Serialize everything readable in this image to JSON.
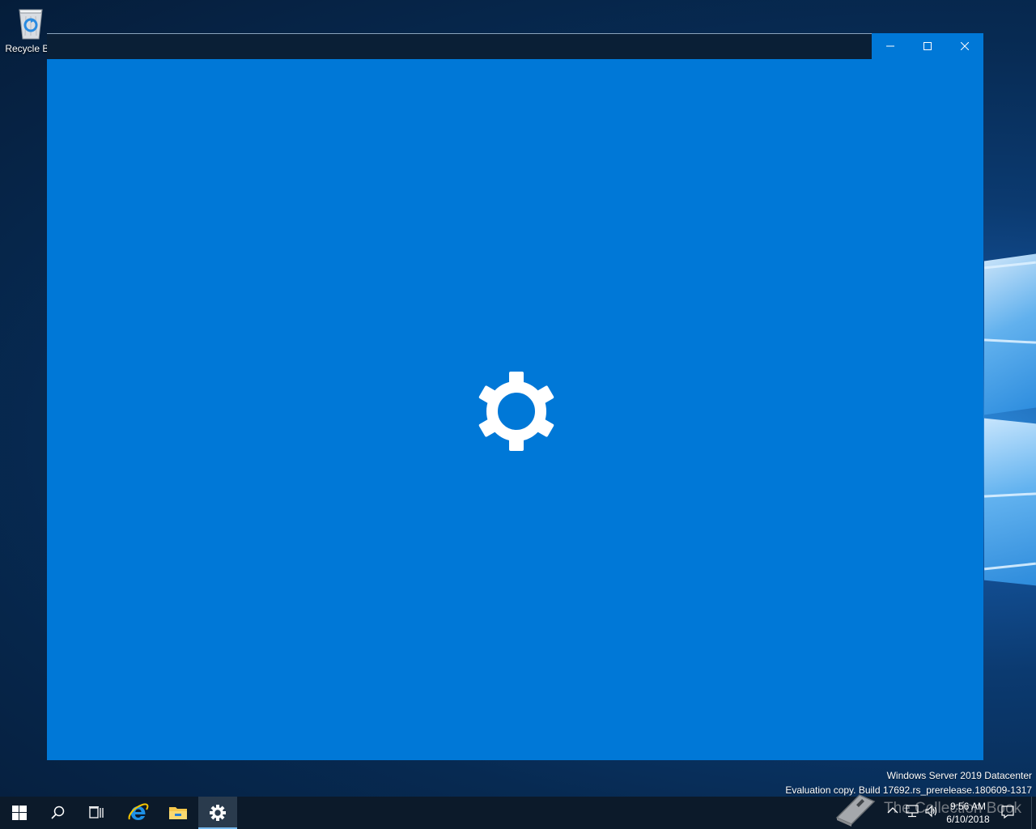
{
  "desktop": {
    "icons": [
      {
        "label": "Recycle Bin",
        "icon": "recycle-bin-icon"
      }
    ]
  },
  "window": {
    "title": "",
    "background_color": "#0078d7",
    "splash_icon": "gear-icon",
    "caption_buttons": [
      "minimize-icon",
      "maximize-icon",
      "close-icon"
    ]
  },
  "watermark": {
    "line1": "Windows Server 2019 Datacenter",
    "line2": "Evaluation copy. Build 17692.rs_prerelease.180609-1317"
  },
  "taskbar": {
    "buttons": [
      "windows-start-icon",
      "search-icon",
      "task-view-icon",
      "internet-explorer-icon",
      "file-explorer-icon",
      "settings-gear-icon"
    ],
    "active": "settings-gear-icon",
    "tray": {
      "icons": [
        "chevron-up-icon",
        "network-icon",
        "volume-icon",
        "notification-icon"
      ],
      "time": "9:56 AM",
      "date": "6/10/2018"
    },
    "overlay_text": "The Collection Book"
  },
  "colors": {
    "accent": "#0078d7",
    "taskbar": "#0c1a2a",
    "active_indicator": "#76b9ed"
  }
}
